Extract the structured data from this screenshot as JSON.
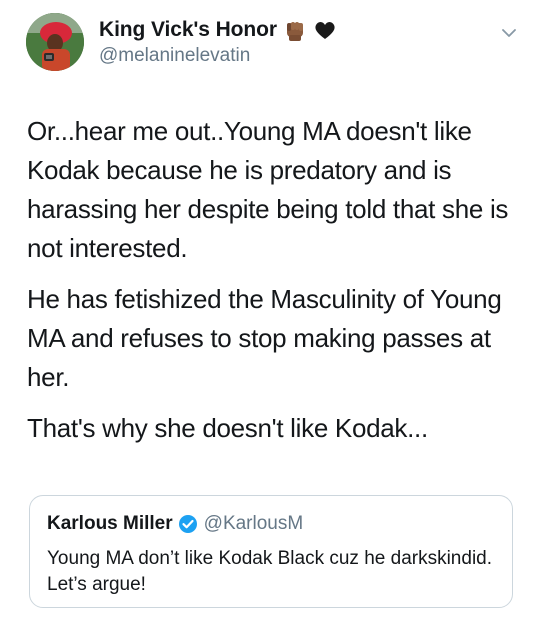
{
  "tweet": {
    "display_name": "King Vick's Honor",
    "handle": "@melaninelevatin",
    "icons": {
      "emoji_1": "raised-fist-dark-skin-icon",
      "emoji_2": "black-heart-icon",
      "menu": "chevron-down-icon"
    },
    "paragraphs": [
      "Or...hear me out..Young MA doesn't like Kodak because he is predatory and is harassing her despite being told that she is not interested.",
      "He has fetishized the Masculinity of Young MA and refuses to stop making passes at her.",
      "That's why she doesn't like Kodak..."
    ]
  },
  "quoted_tweet": {
    "display_name": "Karlous Miller",
    "handle": "@KarlousM",
    "verified_icon": "verified-badge-icon",
    "text": "Young MA don’t like Kodak Black cuz he darkskindid. Let’s argue!"
  },
  "colors": {
    "text_primary": "#14171a",
    "text_secondary": "#657786",
    "border": "#ccd6dd",
    "verified_blue": "#1da1f2",
    "fist_brown": "#8a5a3c"
  }
}
